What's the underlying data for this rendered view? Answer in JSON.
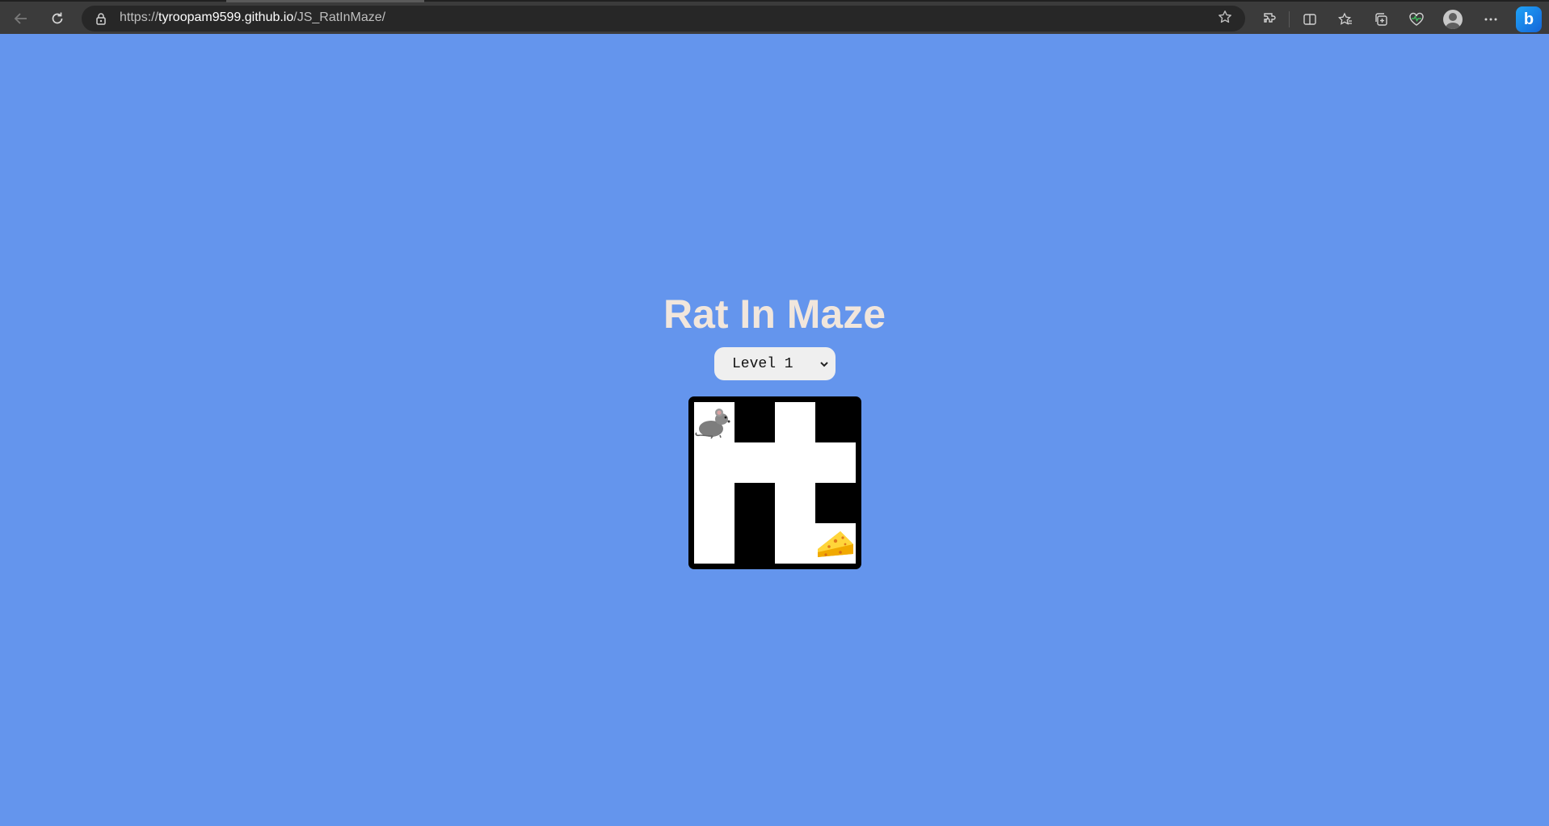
{
  "browser": {
    "url_scheme": "https://",
    "url_host": "tyroopam9599.github.io",
    "url_path": "/JS_RatInMaze/",
    "icons": {
      "back": "back-arrow-icon",
      "reload": "reload-icon",
      "lock": "lock-icon",
      "favorite": "star-icon",
      "extensions": "extensions-icon",
      "split": "split-screen-icon",
      "favorites": "favorites-icon",
      "collections": "collections-icon",
      "health": "browser-essentials-icon",
      "profile": "profile-avatar-icon",
      "menu": "more-menu-icon",
      "copilot": "bing-copilot-icon"
    }
  },
  "page": {
    "title": "Rat In Maze",
    "background_color": "#6495ed",
    "level_select": {
      "selected": "Level 1"
    },
    "maze": {
      "rows": 4,
      "cols": 4,
      "cells": [
        [
          1,
          0,
          1,
          0
        ],
        [
          1,
          1,
          1,
          1
        ],
        [
          1,
          0,
          1,
          0
        ],
        [
          1,
          0,
          1,
          1
        ]
      ],
      "rat_position": [
        0,
        0
      ],
      "cheese_position": [
        3,
        3
      ],
      "wall_color": "#000000",
      "open_color": "#ffffff"
    }
  }
}
